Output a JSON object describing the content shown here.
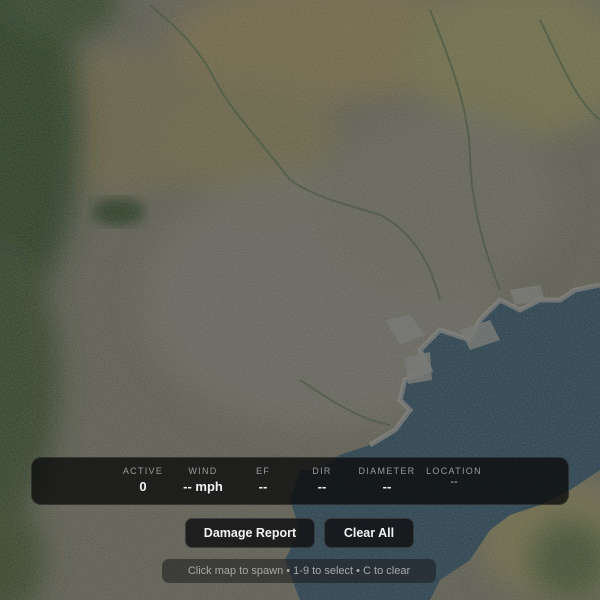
{
  "stats": [
    {
      "label": "ACTIVE",
      "value": "0"
    },
    {
      "label": "WIND",
      "value": "-- mph"
    },
    {
      "label": "EF",
      "value": "--"
    },
    {
      "label": "DIR",
      "value": "--"
    },
    {
      "label": "DIAMETER",
      "value": "--"
    },
    {
      "label": "LOCATION",
      "value": "--"
    }
  ],
  "buttons": {
    "damage_report": "Damage Report",
    "clear_all": "Clear All"
  },
  "hint": "Click map to spawn • 1-9 to select • C to clear",
  "colors": {
    "panel_bg": "#0a0a0c",
    "water": "#1f3847",
    "urban": "#5a5a4e",
    "forest": "#2e3e22",
    "field": "#6d6540"
  }
}
